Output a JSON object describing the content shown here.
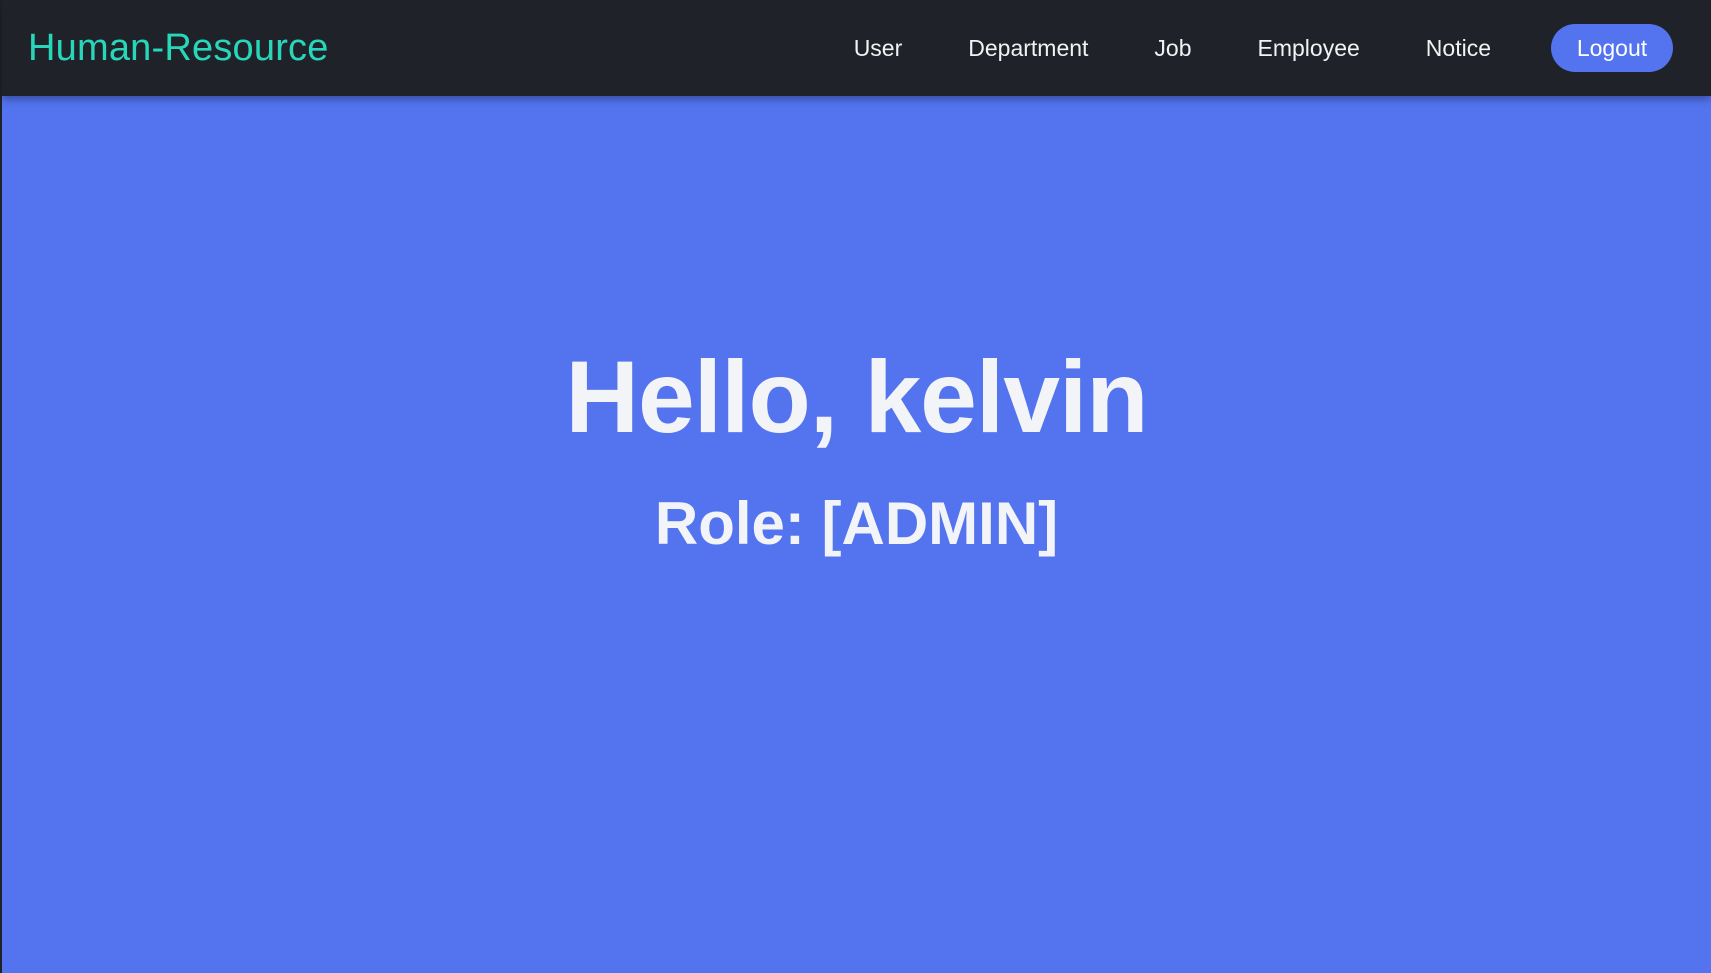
{
  "header": {
    "brand": "Human-Resource",
    "nav": [
      {
        "label": "User"
      },
      {
        "label": "Department"
      },
      {
        "label": "Job"
      },
      {
        "label": "Employee"
      },
      {
        "label": "Notice"
      }
    ],
    "logout_label": "Logout"
  },
  "main": {
    "greeting": "Hello, kelvin",
    "role": "Role: [ADMIN]"
  },
  "colors": {
    "navbar_bg": "#1f2229",
    "brand_accent": "#28d7ba",
    "page_bg": "#5373ef",
    "button_bg": "#5373ef",
    "text_light": "#f3f4f8"
  }
}
